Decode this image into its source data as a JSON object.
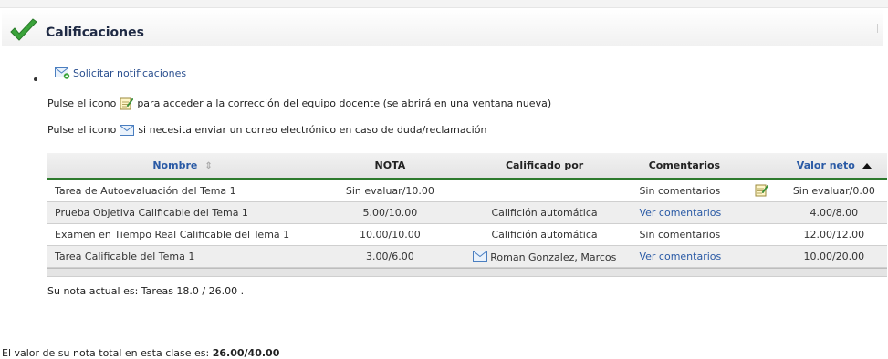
{
  "header": {
    "title": "Calificaciones"
  },
  "links": {
    "notifications": "Solicitar notificaciones"
  },
  "instructions": {
    "pre1": "Pulse el icono",
    "post1": "para acceder a la corrección del equipo docente (se abrirá en una ventana nueva)",
    "pre2": "Pulse el icono",
    "post2": "si necesita enviar un correo electrónico en caso de duda/reclamación"
  },
  "table": {
    "headers": {
      "name": "Nombre",
      "nota": "NOTA",
      "calificado": "Calificado por",
      "comentarios": "Comentarios",
      "valor": "Valor neto"
    },
    "rows": [
      {
        "name": "Tarea de Autoevaluación del Tema 1",
        "nota": "Sin evaluar/10.00",
        "calificado": "",
        "comentarios": "Sin comentarios",
        "valor": "Sin evaluar/0.00"
      },
      {
        "name": "Prueba Objetiva Calificable del Tema 1",
        "nota": "5.00/10.00",
        "calificado": "Califición automática",
        "comentarios": "Ver comentarios",
        "valor": "4.00/8.00"
      },
      {
        "name": "Examen en Tiempo Real Calificable del Tema 1",
        "nota": "10.00/10.00",
        "calificado": "Califición automática",
        "comentarios": "Sin comentarios",
        "valor": "12.00/12.00"
      },
      {
        "name": "Tarea Calificable del Tema 1",
        "nota": "3.00/6.00",
        "calificado": "Roman Gonzalez, Marcos",
        "comentarios": "Ver comentarios",
        "valor": "10.00/20.00"
      }
    ]
  },
  "summary": {
    "current": "Su nota actual es: Tareas 18.0 / 26.00 .",
    "total_label": "El valor de su nota total en esta clase es:",
    "total_value": "26.00/40.00"
  },
  "colors": {
    "accent_green": "#2d7a2d",
    "link_blue": "#2a5aa5",
    "title": "#1f2a44"
  },
  "icons": [
    "check-icon",
    "mail-add-icon",
    "edit-note-icon",
    "envelope-icon",
    "sort-icon",
    "sort-asc-icon"
  ]
}
